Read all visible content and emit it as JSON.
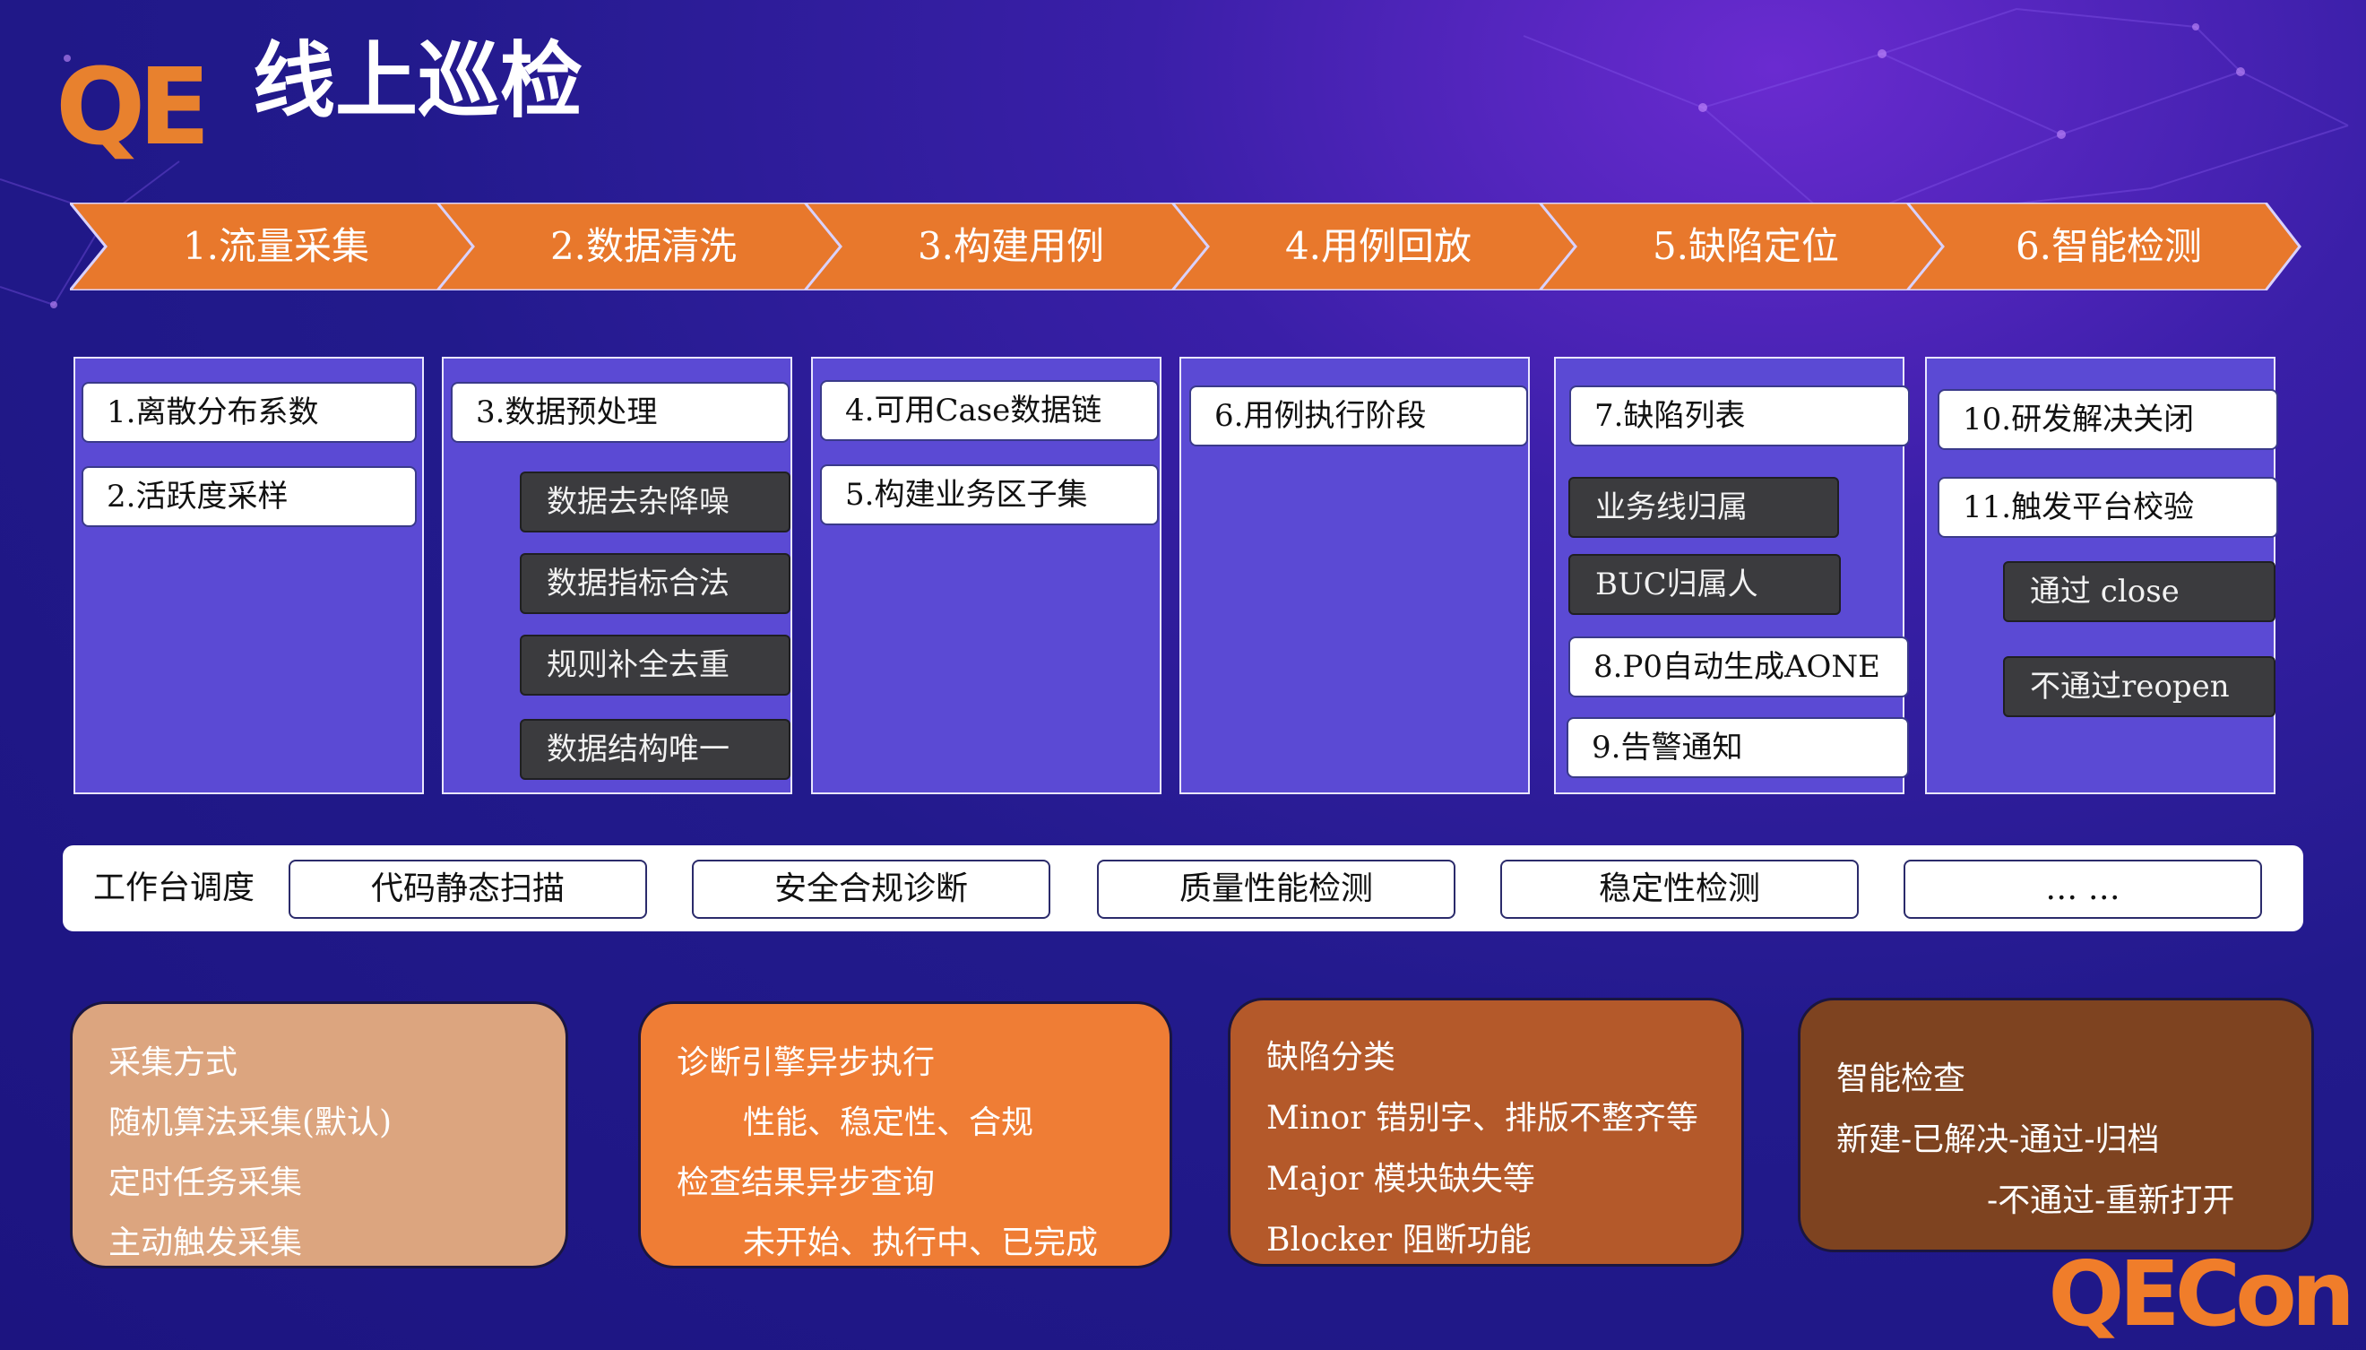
{
  "header": {
    "logo": "QE",
    "title": "线上巡检",
    "brand": "QECon"
  },
  "steps": [
    "1.流量采集",
    "2.数据清洗",
    "3.构建用例",
    "4.用例回放",
    "5.缺陷定位",
    "6.智能检测"
  ],
  "columns": [
    {
      "white": [
        "1.离散分布系数",
        "2.活跃度采样"
      ],
      "dark": []
    },
    {
      "white": [
        "3.数据预处理"
      ],
      "dark": [
        "数据去杂降噪",
        "数据指标合法",
        "规则补全去重",
        "数据结构唯一"
      ]
    },
    {
      "white": [
        "4.可用Case数据链",
        "5.构建业务区子集"
      ],
      "dark": []
    },
    {
      "white": [
        "6.用例执行阶段"
      ],
      "dark": []
    },
    {
      "white": [
        "7.缺陷列表",
        "8.P0自动生成AONE",
        "9.告警通知"
      ],
      "dark": [
        "业务线归属",
        "BUC归属人"
      ]
    },
    {
      "white": [
        "10.研发解决关闭",
        "11.触发平台校验"
      ],
      "dark": [
        "通过 close",
        "不通过reopen"
      ]
    }
  ],
  "workbench": {
    "label": "工作台调度",
    "buttons": [
      "代码静态扫描",
      "安全合规诊断",
      "质量性能检测",
      "稳定性检测",
      "… …"
    ]
  },
  "cards": [
    {
      "lines": [
        "采集方式",
        "随机算法采集(默认)",
        "定时任务采集",
        "主动触发采集"
      ]
    },
    {
      "lines": [
        "诊断引擎异步执行",
        "性能、稳定性、合规",
        "检查结果异步查询",
        "未开始、执行中、已完成"
      ]
    },
    {
      "lines": [
        "缺陷分类",
        "Minor 错别字、排版不整齐等",
        "Major  模块缺失等",
        "Blocker 阻断功能"
      ]
    },
    {
      "lines": [
        "智能检查",
        "新建-已解决-通过-归档",
        "-不通过-重新打开"
      ]
    }
  ],
  "colors": {
    "accent": "#e8782c",
    "column_bg": "#5b4ad4",
    "card1": "#dca57f",
    "card2": "#ef7d35",
    "card3": "#b4592a",
    "card4": "#7e4320"
  }
}
